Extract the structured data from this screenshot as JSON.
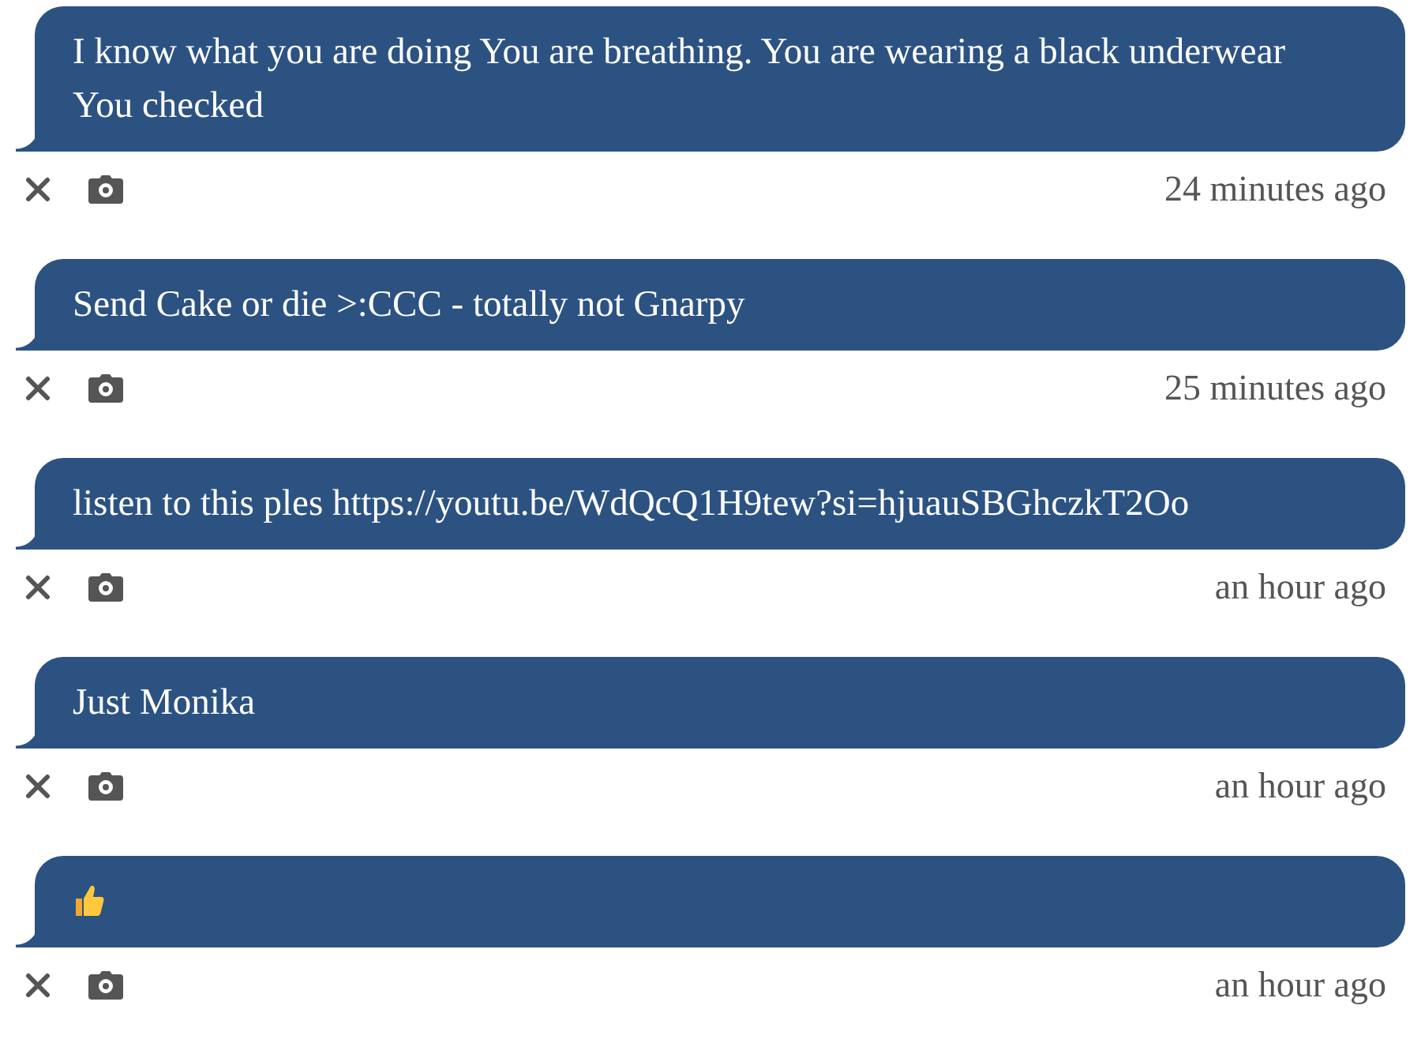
{
  "messages": [
    {
      "kind": "text",
      "text": "I know what you are doing You are breathing. You are wearing a black underwear You checked",
      "time": "24 minutes ago"
    },
    {
      "kind": "text",
      "text": "Send Cake or die >:CCC - totally not Gnarpy",
      "time": "25 minutes ago"
    },
    {
      "kind": "text",
      "text": "listen to this ples https://youtu.be/WdQcQ1H9tew?si=hjuauSBGhczkT2Oo",
      "time": "an hour ago"
    },
    {
      "kind": "text",
      "text": "Just Monika",
      "time": "an hour ago"
    },
    {
      "kind": "thumbs-up",
      "time": "an hour ago"
    }
  ]
}
